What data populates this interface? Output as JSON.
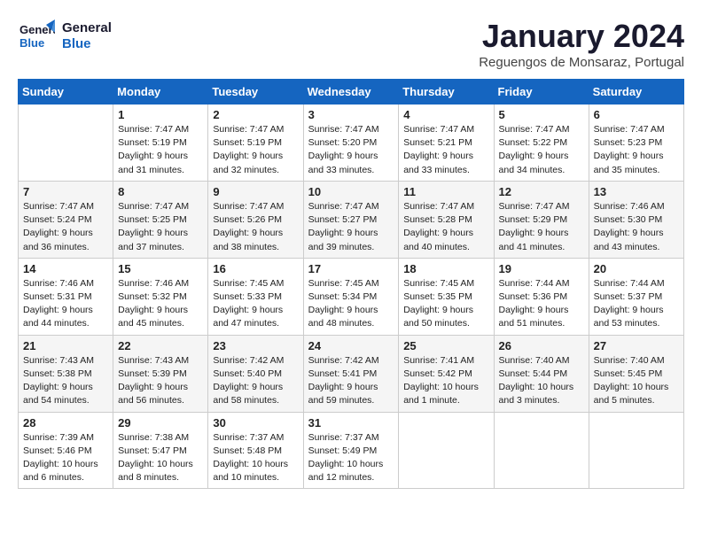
{
  "logo": {
    "line1": "General",
    "line2": "Blue"
  },
  "title": "January 2024",
  "location": "Reguengos de Monsaraz, Portugal",
  "days_of_week": [
    "Sunday",
    "Monday",
    "Tuesday",
    "Wednesday",
    "Thursday",
    "Friday",
    "Saturday"
  ],
  "weeks": [
    [
      {
        "day": "",
        "sunrise": "",
        "sunset": "",
        "daylight": ""
      },
      {
        "day": "1",
        "sunrise": "Sunrise: 7:47 AM",
        "sunset": "Sunset: 5:19 PM",
        "daylight": "Daylight: 9 hours and 31 minutes."
      },
      {
        "day": "2",
        "sunrise": "Sunrise: 7:47 AM",
        "sunset": "Sunset: 5:19 PM",
        "daylight": "Daylight: 9 hours and 32 minutes."
      },
      {
        "day": "3",
        "sunrise": "Sunrise: 7:47 AM",
        "sunset": "Sunset: 5:20 PM",
        "daylight": "Daylight: 9 hours and 33 minutes."
      },
      {
        "day": "4",
        "sunrise": "Sunrise: 7:47 AM",
        "sunset": "Sunset: 5:21 PM",
        "daylight": "Daylight: 9 hours and 33 minutes."
      },
      {
        "day": "5",
        "sunrise": "Sunrise: 7:47 AM",
        "sunset": "Sunset: 5:22 PM",
        "daylight": "Daylight: 9 hours and 34 minutes."
      },
      {
        "day": "6",
        "sunrise": "Sunrise: 7:47 AM",
        "sunset": "Sunset: 5:23 PM",
        "daylight": "Daylight: 9 hours and 35 minutes."
      }
    ],
    [
      {
        "day": "7",
        "sunrise": "Sunrise: 7:47 AM",
        "sunset": "Sunset: 5:24 PM",
        "daylight": "Daylight: 9 hours and 36 minutes."
      },
      {
        "day": "8",
        "sunrise": "Sunrise: 7:47 AM",
        "sunset": "Sunset: 5:25 PM",
        "daylight": "Daylight: 9 hours and 37 minutes."
      },
      {
        "day": "9",
        "sunrise": "Sunrise: 7:47 AM",
        "sunset": "Sunset: 5:26 PM",
        "daylight": "Daylight: 9 hours and 38 minutes."
      },
      {
        "day": "10",
        "sunrise": "Sunrise: 7:47 AM",
        "sunset": "Sunset: 5:27 PM",
        "daylight": "Daylight: 9 hours and 39 minutes."
      },
      {
        "day": "11",
        "sunrise": "Sunrise: 7:47 AM",
        "sunset": "Sunset: 5:28 PM",
        "daylight": "Daylight: 9 hours and 40 minutes."
      },
      {
        "day": "12",
        "sunrise": "Sunrise: 7:47 AM",
        "sunset": "Sunset: 5:29 PM",
        "daylight": "Daylight: 9 hours and 41 minutes."
      },
      {
        "day": "13",
        "sunrise": "Sunrise: 7:46 AM",
        "sunset": "Sunset: 5:30 PM",
        "daylight": "Daylight: 9 hours and 43 minutes."
      }
    ],
    [
      {
        "day": "14",
        "sunrise": "Sunrise: 7:46 AM",
        "sunset": "Sunset: 5:31 PM",
        "daylight": "Daylight: 9 hours and 44 minutes."
      },
      {
        "day": "15",
        "sunrise": "Sunrise: 7:46 AM",
        "sunset": "Sunset: 5:32 PM",
        "daylight": "Daylight: 9 hours and 45 minutes."
      },
      {
        "day": "16",
        "sunrise": "Sunrise: 7:45 AM",
        "sunset": "Sunset: 5:33 PM",
        "daylight": "Daylight: 9 hours and 47 minutes."
      },
      {
        "day": "17",
        "sunrise": "Sunrise: 7:45 AM",
        "sunset": "Sunset: 5:34 PM",
        "daylight": "Daylight: 9 hours and 48 minutes."
      },
      {
        "day": "18",
        "sunrise": "Sunrise: 7:45 AM",
        "sunset": "Sunset: 5:35 PM",
        "daylight": "Daylight: 9 hours and 50 minutes."
      },
      {
        "day": "19",
        "sunrise": "Sunrise: 7:44 AM",
        "sunset": "Sunset: 5:36 PM",
        "daylight": "Daylight: 9 hours and 51 minutes."
      },
      {
        "day": "20",
        "sunrise": "Sunrise: 7:44 AM",
        "sunset": "Sunset: 5:37 PM",
        "daylight": "Daylight: 9 hours and 53 minutes."
      }
    ],
    [
      {
        "day": "21",
        "sunrise": "Sunrise: 7:43 AM",
        "sunset": "Sunset: 5:38 PM",
        "daylight": "Daylight: 9 hours and 54 minutes."
      },
      {
        "day": "22",
        "sunrise": "Sunrise: 7:43 AM",
        "sunset": "Sunset: 5:39 PM",
        "daylight": "Daylight: 9 hours and 56 minutes."
      },
      {
        "day": "23",
        "sunrise": "Sunrise: 7:42 AM",
        "sunset": "Sunset: 5:40 PM",
        "daylight": "Daylight: 9 hours and 58 minutes."
      },
      {
        "day": "24",
        "sunrise": "Sunrise: 7:42 AM",
        "sunset": "Sunset: 5:41 PM",
        "daylight": "Daylight: 9 hours and 59 minutes."
      },
      {
        "day": "25",
        "sunrise": "Sunrise: 7:41 AM",
        "sunset": "Sunset: 5:42 PM",
        "daylight": "Daylight: 10 hours and 1 minute."
      },
      {
        "day": "26",
        "sunrise": "Sunrise: 7:40 AM",
        "sunset": "Sunset: 5:44 PM",
        "daylight": "Daylight: 10 hours and 3 minutes."
      },
      {
        "day": "27",
        "sunrise": "Sunrise: 7:40 AM",
        "sunset": "Sunset: 5:45 PM",
        "daylight": "Daylight: 10 hours and 5 minutes."
      }
    ],
    [
      {
        "day": "28",
        "sunrise": "Sunrise: 7:39 AM",
        "sunset": "Sunset: 5:46 PM",
        "daylight": "Daylight: 10 hours and 6 minutes."
      },
      {
        "day": "29",
        "sunrise": "Sunrise: 7:38 AM",
        "sunset": "Sunset: 5:47 PM",
        "daylight": "Daylight: 10 hours and 8 minutes."
      },
      {
        "day": "30",
        "sunrise": "Sunrise: 7:37 AM",
        "sunset": "Sunset: 5:48 PM",
        "daylight": "Daylight: 10 hours and 10 minutes."
      },
      {
        "day": "31",
        "sunrise": "Sunrise: 7:37 AM",
        "sunset": "Sunset: 5:49 PM",
        "daylight": "Daylight: 10 hours and 12 minutes."
      },
      {
        "day": "",
        "sunrise": "",
        "sunset": "",
        "daylight": ""
      },
      {
        "day": "",
        "sunrise": "",
        "sunset": "",
        "daylight": ""
      },
      {
        "day": "",
        "sunrise": "",
        "sunset": "",
        "daylight": ""
      }
    ]
  ]
}
